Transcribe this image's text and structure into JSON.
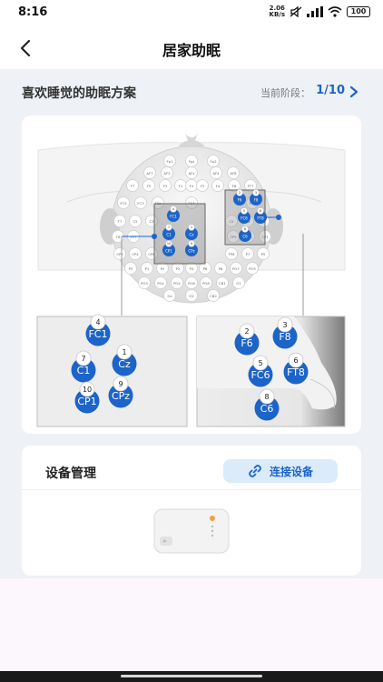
{
  "status": {
    "time": "8:16",
    "net_speed_value": "2.06",
    "net_speed_unit": "KB/s",
    "battery": "100"
  },
  "header": {
    "title": "居家助眠"
  },
  "plan": {
    "title": "喜欢睡觉的助眠方案",
    "stage_label": "当前阶段：",
    "stage_value": "1/10"
  },
  "eeg": {
    "small_labels": [
      "Fp1",
      "Fpz",
      "Fp2",
      "AF7",
      "AF3",
      "AFz",
      "AF4",
      "AF8",
      "F7",
      "F5",
      "F3",
      "F1",
      "Fz",
      "F2",
      "F4",
      "F8",
      "FT7",
      "FC5",
      "FC3",
      "FCz",
      "FC4",
      "FT8",
      "T7",
      "C5",
      "C3",
      "C2",
      "C4",
      "C6",
      "T8",
      "TP7",
      "CP5",
      "CP3",
      "CP1",
      "CP2",
      "CP4",
      "CP6",
      "TP8",
      "P7",
      "P5",
      "P3",
      "P1",
      "Pz",
      "P2",
      "P4",
      "P6",
      "P8",
      "PO7",
      "PO5",
      "PO3",
      "POz",
      "PO4",
      "PO6",
      "PO8",
      "CB1",
      "O1",
      "Oz",
      "O2",
      "CB2"
    ],
    "left_zoom": [
      {
        "num": "4",
        "label": "FC1"
      },
      {
        "num": "7",
        "label": "C1"
      },
      {
        "num": "1",
        "label": "Cz"
      },
      {
        "num": "10",
        "label": "CP1"
      },
      {
        "num": "9",
        "label": "CPz"
      }
    ],
    "right_zoom": [
      {
        "num": "2",
        "label": "F6"
      },
      {
        "num": "3",
        "label": "F8"
      },
      {
        "num": "5",
        "label": "FC6"
      },
      {
        "num": "6",
        "label": "FT8"
      },
      {
        "num": "8",
        "label": "C6"
      }
    ]
  },
  "device": {
    "title": "设备管理",
    "connect_label": "连接设备"
  }
}
